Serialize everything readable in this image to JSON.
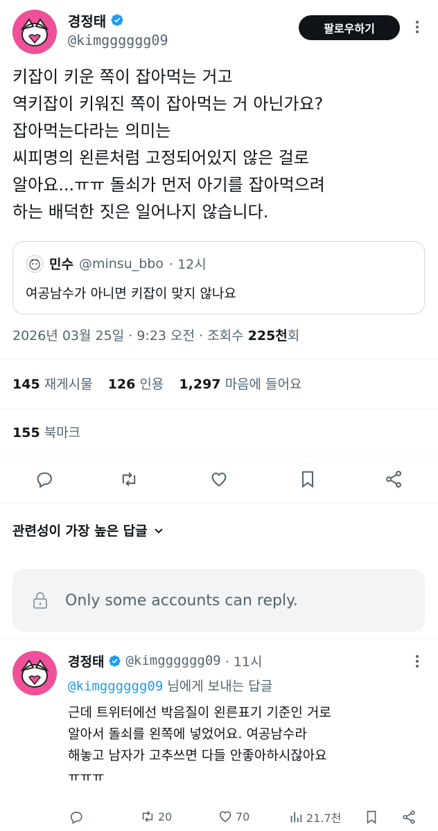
{
  "colors": {
    "accent": "#1d9bf0",
    "avatar_bg": "#f0509a",
    "follow_bg": "#0f1419"
  },
  "author": {
    "name": "경정태",
    "handle": "@kimgggggg09",
    "verified": true
  },
  "follow_label": "팔로우하기",
  "tweet": {
    "lines": [
      "키잡이 키운 쪽이 잡아먹는 거고",
      "역키잡이 키워진 쪽이 잡아먹는 거 아닌가요?",
      "잡아먹는다라는 의미는",
      "씨피명의 왼른처럼 고정되어있지 않은 걸로",
      "알아요...ㅠㅠ 돌쇠가 먼저 아기를 잡아먹으려",
      "하는 배덕한 짓은 일어나지 않습니다."
    ]
  },
  "quote": {
    "name": "민수",
    "handle": "@minsu_bbo",
    "time": "· 12시",
    "text": "여공남수가 아니면 키잡이 맞지 않나요"
  },
  "meta": {
    "date": "2026년 03월 25일 · 9:23 오전 · 조회수 ",
    "views": "225천",
    "views_suffix": "회"
  },
  "stats": {
    "retweets": "145",
    "retweets_label": "재게시물",
    "quotes": "126",
    "quotes_label": "인용",
    "likes": "1,297",
    "likes_label": "마음에 들어요",
    "bookmarks": "155",
    "bookmarks_label": "북마크"
  },
  "replies_sort": "관련성이 가장 높은 답글",
  "reply_restriction": "Only some accounts can reply.",
  "reply": {
    "name": "경정태",
    "handle": "@kimgggggg09",
    "time": "· 11시",
    "replying_to_handle": "@kimgggggg09",
    "replying_to_suffix": " 님에게 보내는 답글",
    "lines": [
      "근데 트위터에선 박음질이 왼른표기 기준인 거로",
      "알아서 돌쇠를 왼쪽에 넣었어요. 여공남수라",
      "해놓고 남자가 고추쓰면 다들 안좋아하시잖아요",
      "ㅠㅠㅠ"
    ],
    "retweets": "20",
    "likes": "70",
    "views": "21.7천"
  }
}
